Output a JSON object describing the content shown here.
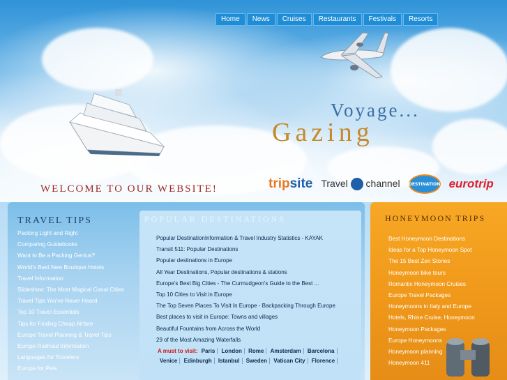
{
  "nav": [
    "Home",
    "News",
    "Cruises",
    "Restaurants",
    "Festivals",
    "Resorts"
  ],
  "logo": {
    "line1": "Voyage...",
    "line2": "Gazing"
  },
  "welcome": "Welcome to our website!",
  "partners": {
    "tripsite": "tripsite",
    "travel_channel": "Travel channel",
    "destination": "DESTINATION",
    "eurotrip": "eurotrip"
  },
  "travel_tips": {
    "title": "Travel Tips",
    "items": [
      "Packing Light and Right",
      "Comparing Guidebooks",
      "Want to Be a Packing Genius?",
      "World's Best New Boutique Hotels",
      "Travel Information",
      "Slideshow: The Most Magical Canal Cities",
      "Travel Tips You've Never Heard",
      "Top 10 Travel Essentials",
      "Tips for Finding Cheap Airfare",
      "Europe Travel Planning & Travel Tips",
      "Europe Railroad Information",
      "Languages for Travelers",
      "Europe for Pets"
    ]
  },
  "popular": {
    "title": "Popular Destinations",
    "items": [
      "Popular DestinationInformation & Travel Industry Statistics - KAYAK",
      "Transit 511: Popular Destinations",
      "Popular destinations in Europe",
      "All Year Destinations, Popular destinations & stations",
      "Europe's Best Big Cities - The Curmudgeon's Guide to the Best ...",
      "Top 10 Cities to Visit in Europe",
      "The Top Seven Places To Visit In Europe - Backpacking Through Europe",
      "Best places to visit in Europe: Towns and villages",
      "Beautiful Fountains from Across the World",
      "29 of the Most Amazing Waterfalls"
    ],
    "must_label": "A must to visit:",
    "cities": [
      "Paris",
      "London",
      "Rome",
      "Amsterdam",
      "Barcelona",
      "Venice",
      "Edinburgh",
      "Istanbul",
      "Sweden",
      "Vatican City",
      "Florence"
    ]
  },
  "honeymoon": {
    "title": "Honeymoon Trips",
    "items": [
      "Best Honeymoon Destinations",
      "Ideas for a Top Honeymoon Spot",
      "The 15 Best Zen Stories",
      "Honeymoon bike tours",
      "Romantic Honeymoon Cruises",
      "Europe Travel Packages",
      "Honeymoons in Italy and Europe",
      "Hotels, Rhine Cruise, Honeymoon",
      "Honeymoon Packages",
      "Europe Honeymoons",
      "Honeymoon planning",
      "Honeymoon 411"
    ]
  }
}
